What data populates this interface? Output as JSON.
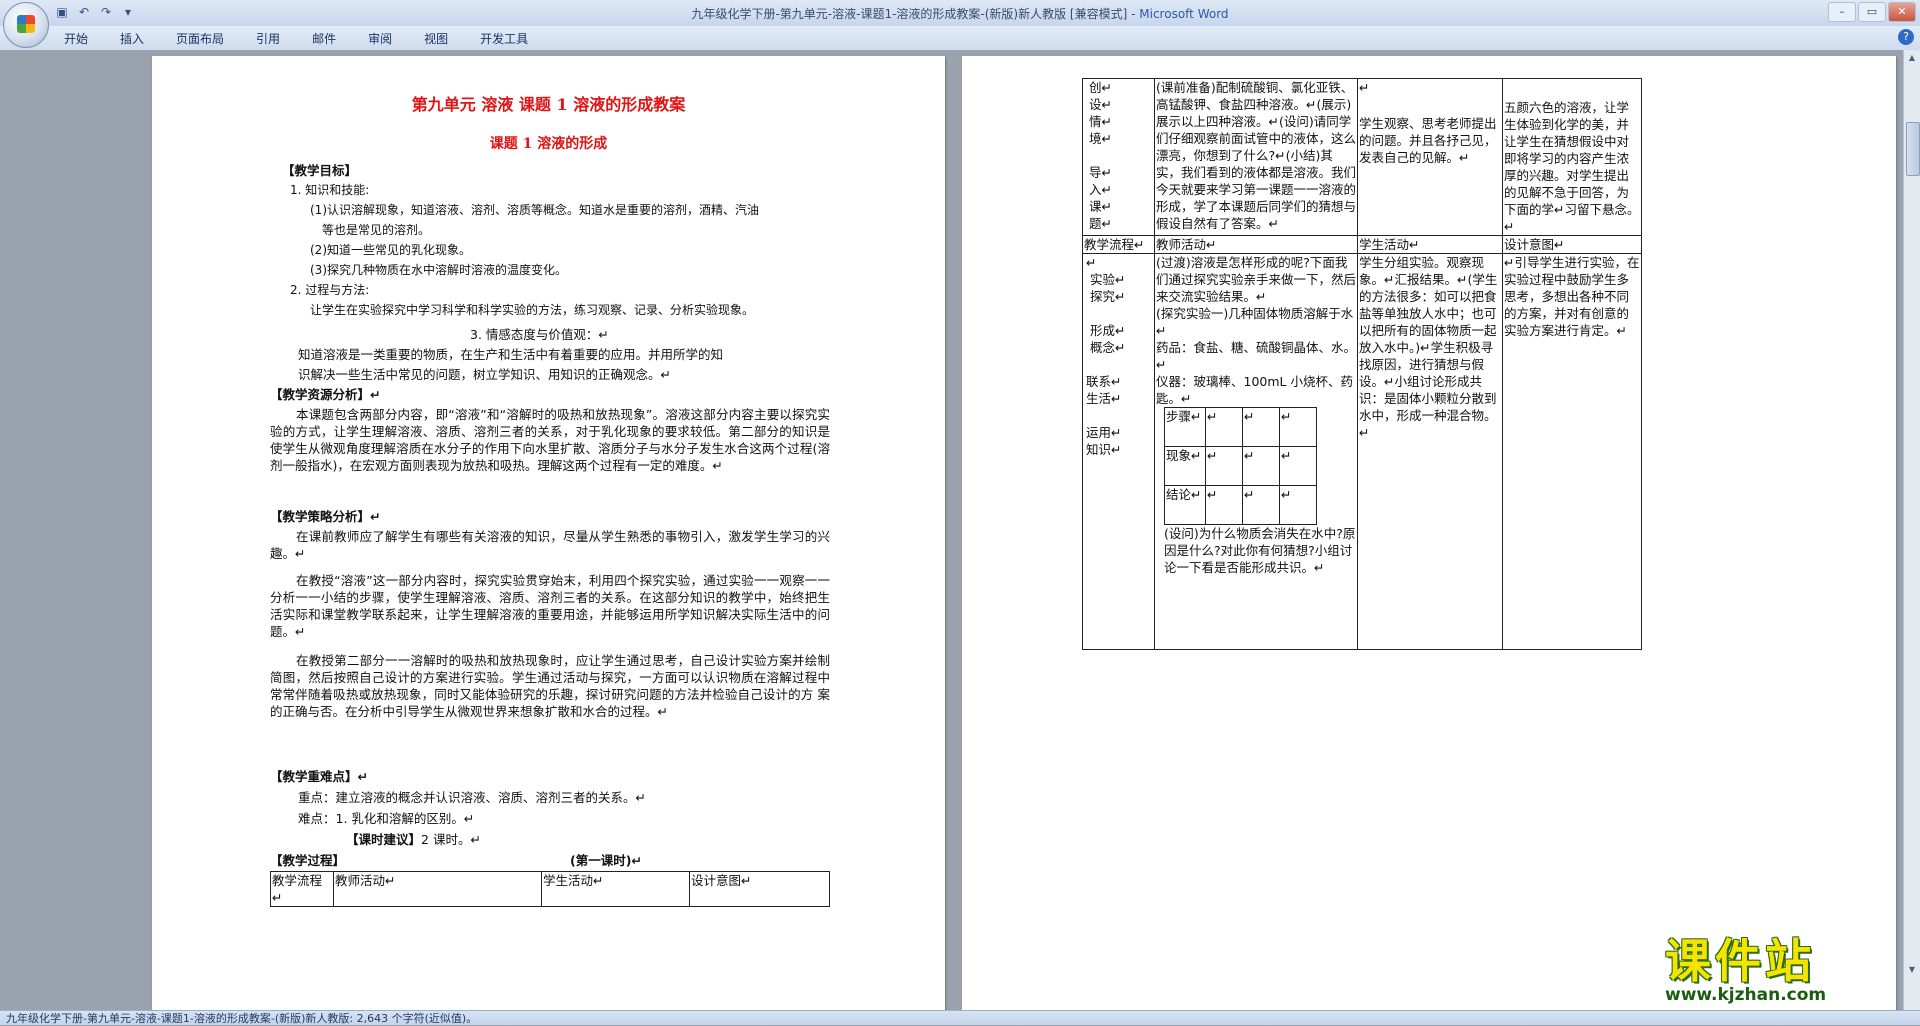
{
  "window": {
    "title": "九年级化学下册-第九单元-溶液-课题1-溶液的形成教案-(新版)新人教版 [兼容模式] -",
    "app_name": "Microsoft Word",
    "qat": [
      "save-icon",
      "undo-icon",
      "redo-icon",
      "customize-icon"
    ]
  },
  "ribbon": {
    "tabs": [
      "开始",
      "插入",
      "页面布局",
      "引用",
      "邮件",
      "审阅",
      "视图",
      "开发工具"
    ]
  },
  "left_page": {
    "title": "第九单元  溶液  课题 1  溶液的形成教案",
    "subtitle": "课题 1    溶液的形成",
    "goal_heading": "【教学目标】",
    "goal_1": "1. 知识和技能:",
    "goal_1a": "(1)认识溶解现象，知道溶液、溶剂、溶质等概念。知道水是重要的溶剂，酒精、汽油",
    "goal_1a2": "等也是常见的溶剂。",
    "goal_1b": "(2)知道一些常见的乳化现象。",
    "goal_1c": "(3)探究几种物质在水中溶解时溶液的温度变化。",
    "goal_2": "2. 过程与方法:",
    "goal_2a": "让学生在实验探究中学习科学和科学实验的方法，练习观察、记录、分析实验现象。",
    "goal_3": "3. 情感态度与价值观：↵",
    "goal_3a": "知道溶液是一类重要的物质，在生产和生活中有着重要的应用。并用所学的知",
    "goal_3a2": "识解决一些生活中常见的问题，树立学知识、用知识的正确观念。↵",
    "res_heading": "【教学资源分析】↵",
    "res_p": "本课题包含两部分内容，即“溶液”和“溶解时的吸热和放热现象”。溶液这部分内容主要以探究实验的方式，让学生理解溶液、溶质、溶剂三者的关系，对于乳化现象的要求较低。第二部分的知识是使学生从微观角度理解溶质在水分子的作用下向水里扩散、溶质分子与水分子发生水合这两个过程(溶剂一般指水)，在宏观方面则表现为放热和吸热。理解这两个过程有一定的难度。↵",
    "strat_heading": "【教学策略分析】↵",
    "strat_p1": "在课前教师应了解学生有哪些有关溶液的知识，尽量从学生熟悉的事物引入，激发学生学习的兴趣。↵",
    "strat_p2": "在教授“溶液”这一部分内容时，探究实验贯穿始末，利用四个探究实验，通过实验一一观察一一分析一一小结的步骤，使学生理解溶液、溶质、溶剂三者的关系。在这部分知识的教学中，始终把生活实际和课堂教学联系起来，让学生理解溶液的重要用途，并能够运用所学知识解决实际生活中的问题。↵",
    "strat_p3": "在教授第二部分一一溶解时的吸热和放热现象时，应让学生通过思考，自己设计实验方案并绘制简图，然后按照自己设计的方案进行实验。学生通过活动与探究，一方面可以认识物质在溶解过程中常常伴随着吸热或放热现象，同时又能体验研究的乐趣，探讨研究问题的方法并检验自己设计的方 案的正确与否。在分析中引导学生从微观世界来想象扩散和水合的过程。↵",
    "key_heading": "【教学重难点】↵",
    "key_1": "重点：建立溶液的概念并认识溶液、溶质、溶剂三者的关系。↵",
    "key_2": "难点：1. 乳化和溶解的区别。↵",
    "hours": "【课时建议】2 课时。↵",
    "hours_label": "【课时建议】",
    "hours_value": "2 课时。↵",
    "process_heading": "【教学过程】",
    "process_period": "(第一课时)↵",
    "table_headers": [
      "教学流程↵",
      "教师活动↵",
      "学生活动↵",
      "设计意图↵"
    ]
  },
  "right_page": {
    "row1": {
      "phase": [
        "创↵",
        "设↵",
        "情↵",
        "境↵",
        "",
        "导↵",
        "入↵",
        "课↵",
        "题↵"
      ],
      "teacher": "(课前准备)配制硫酸铜、氯化亚铁、高锰酸钾、食盐四种溶液。↵(展示)展示以上四种溶液。↵(设问)请同学们仔细观察前面试管中的液体，这么漂亮，你想到了什么?↵(小结)其实，我们看到的液体都是溶液。我们今天就要来学习第一课题一一溶液的形成，学了本课题后同学们的猜想与假设自然有了答案。↵",
      "student_top": "↵",
      "student": "学生观察、思考老师提出的问题。并且各抒己见，发表自己的见解。↵",
      "intent": "五颜六色的溶液，让学生体验到化学的美，并让学生在猜想假设中对即将学习的内容产生浓厚的兴趣。对学生提出的见解不急于回答，为下面的学↵习留下悬念。↵"
    },
    "header": [
      "教学流程↵",
      "教师活动↵",
      "学生活动↵",
      "设计意图↵"
    ],
    "row2": {
      "phase": [
        "↵",
        "实验↵",
        "探究↵",
        "",
        "形成↵",
        "概念↵",
        "",
        "联系↵",
        "生活↵",
        "",
        "运用↵",
        "知识↵"
      ],
      "teacher_1": "(过渡)溶液是怎样形成的呢?下面我们通过探究实验亲手来做一下，然后来交流实验结果。↵",
      "teacher_2": "(探究实验一)几种固体物质溶解于水↵",
      "teacher_3": "药品：食盐、糖、硫酸铜晶体、水。↵",
      "teacher_4": "仪器：玻璃棒、100mL 小烧杯、药匙。↵",
      "grid_labels": [
        "步骤↵",
        "现象↵",
        "结论↵"
      ],
      "teacher_5": "(设问)为什么物质会消失在水中?原因是什么?对此你有何猜想?小组讨论一下看是否能形成共识。↵",
      "student": "学生分组实验。观察现象。↵汇报结果。↵(学生的方法很多：如可以把食盐等单独放人水中；也可以把所有的固体物质一起放入水中。)↵学生积极寻找原因，进行猜想与假设。↵小组讨论形成共识：是固体小颗粒分散到水中，形成一种混合物。↵",
      "intent": "↵引导学生进行实验，在实验过程中鼓励学生多思考，多想出各种不同的方案，并对有创意的实验方案进行肯定。↵"
    }
  },
  "status": "九年级化学下册-第九单元-溶液-课题1-溶液的形成教案-(新版)新人教版: 2,643 个字符(近似值)。",
  "watermark": {
    "text": "课件站",
    "url": "www.kjzhan.com"
  }
}
